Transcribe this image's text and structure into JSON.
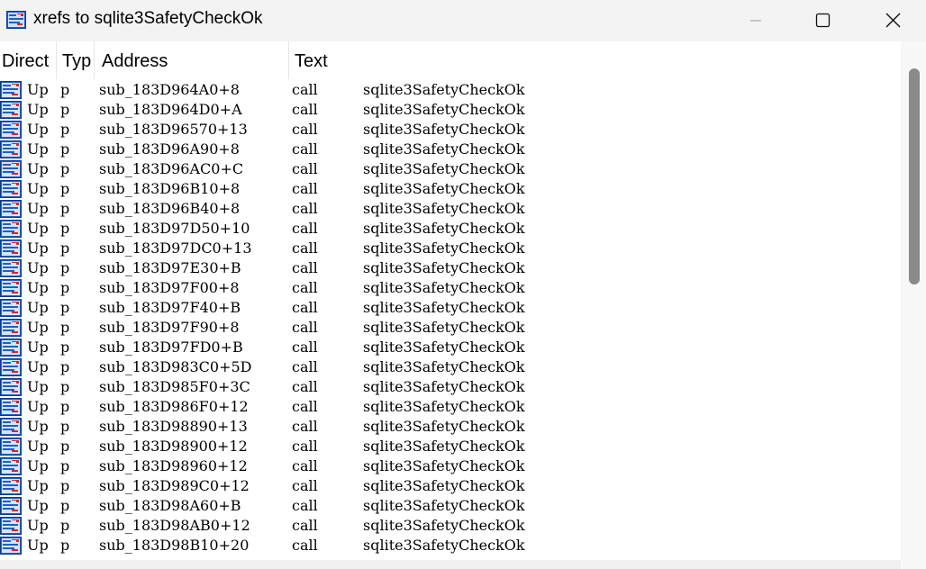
{
  "window": {
    "title": "xrefs to sqlite3SafetyCheckOk"
  },
  "columns": [
    "Direct",
    "Typ",
    "Address",
    "Text"
  ],
  "rows": [
    {
      "dir": "Up",
      "typ": "p",
      "address": "sub_183D964A0+8",
      "text": "call",
      "target": "sqlite3SafetyCheckOk"
    },
    {
      "dir": "Up",
      "typ": "p",
      "address": "sub_183D964D0+A",
      "text": "call",
      "target": "sqlite3SafetyCheckOk"
    },
    {
      "dir": "Up",
      "typ": "p",
      "address": "sub_183D96570+13",
      "text": "call",
      "target": "sqlite3SafetyCheckOk"
    },
    {
      "dir": "Up",
      "typ": "p",
      "address": "sub_183D96A90+8",
      "text": "call",
      "target": "sqlite3SafetyCheckOk"
    },
    {
      "dir": "Up",
      "typ": "p",
      "address": "sub_183D96AC0+C",
      "text": "call",
      "target": "sqlite3SafetyCheckOk"
    },
    {
      "dir": "Up",
      "typ": "p",
      "address": "sub_183D96B10+8",
      "text": "call",
      "target": "sqlite3SafetyCheckOk"
    },
    {
      "dir": "Up",
      "typ": "p",
      "address": "sub_183D96B40+8",
      "text": "call",
      "target": "sqlite3SafetyCheckOk"
    },
    {
      "dir": "Up",
      "typ": "p",
      "address": "sub_183D97D50+10",
      "text": "call",
      "target": "sqlite3SafetyCheckOk"
    },
    {
      "dir": "Up",
      "typ": "p",
      "address": "sub_183D97DC0+13",
      "text": "call",
      "target": "sqlite3SafetyCheckOk"
    },
    {
      "dir": "Up",
      "typ": "p",
      "address": "sub_183D97E30+B",
      "text": "call",
      "target": "sqlite3SafetyCheckOk"
    },
    {
      "dir": "Up",
      "typ": "p",
      "address": "sub_183D97F00+8",
      "text": "call",
      "target": "sqlite3SafetyCheckOk"
    },
    {
      "dir": "Up",
      "typ": "p",
      "address": "sub_183D97F40+B",
      "text": "call",
      "target": "sqlite3SafetyCheckOk"
    },
    {
      "dir": "Up",
      "typ": "p",
      "address": "sub_183D97F90+8",
      "text": "call",
      "target": "sqlite3SafetyCheckOk"
    },
    {
      "dir": "Up",
      "typ": "p",
      "address": "sub_183D97FD0+B",
      "text": "call",
      "target": "sqlite3SafetyCheckOk"
    },
    {
      "dir": "Up",
      "typ": "p",
      "address": "sub_183D983C0+5D",
      "text": "call",
      "target": "sqlite3SafetyCheckOk"
    },
    {
      "dir": "Up",
      "typ": "p",
      "address": "sub_183D985F0+3C",
      "text": "call",
      "target": "sqlite3SafetyCheckOk"
    },
    {
      "dir": "Up",
      "typ": "p",
      "address": "sub_183D986F0+12",
      "text": "call",
      "target": "sqlite3SafetyCheckOk"
    },
    {
      "dir": "Up",
      "typ": "p",
      "address": "sub_183D98890+13",
      "text": "call",
      "target": "sqlite3SafetyCheckOk"
    },
    {
      "dir": "Up",
      "typ": "p",
      "address": "sub_183D98900+12",
      "text": "call",
      "target": "sqlite3SafetyCheckOk"
    },
    {
      "dir": "Up",
      "typ": "p",
      "address": "sub_183D98960+12",
      "text": "call",
      "target": "sqlite3SafetyCheckOk"
    },
    {
      "dir": "Up",
      "typ": "p",
      "address": "sub_183D989C0+12",
      "text": "call",
      "target": "sqlite3SafetyCheckOk"
    },
    {
      "dir": "Up",
      "typ": "p",
      "address": "sub_183D98A60+B",
      "text": "call",
      "target": "sqlite3SafetyCheckOk"
    },
    {
      "dir": "Up",
      "typ": "p",
      "address": "sub_183D98AB0+12",
      "text": "call",
      "target": "sqlite3SafetyCheckOk"
    },
    {
      "dir": "Up",
      "typ": "p",
      "address": "sub_183D98B10+20",
      "text": "call",
      "target": "sqlite3SafetyCheckOk"
    }
  ]
}
